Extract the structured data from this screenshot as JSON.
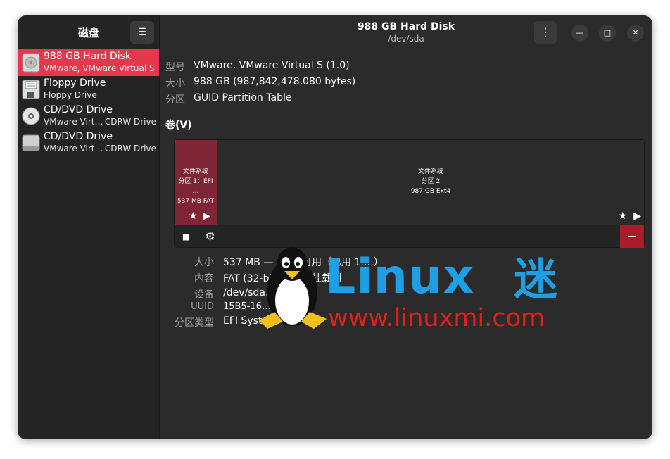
{
  "sidebar": {
    "title": "磁盘",
    "devices": [
      {
        "name": "988 GB Hard Disk",
        "sub": "VMware, VMware Virtual S",
        "sub2": "",
        "icon": "hard-disk-icon"
      },
      {
        "name": "Floppy Drive",
        "sub": "Floppy Drive",
        "sub2": "",
        "icon": "floppy-icon"
      },
      {
        "name": "CD/DVD Drive",
        "sub": "VMware Virt…",
        "sub2": "CDRW Drive",
        "icon": "cd-icon"
      },
      {
        "name": "CD/DVD Drive",
        "sub": "VMware Virt…",
        "sub2": "CDRW Drive",
        "icon": "drive-icon"
      }
    ]
  },
  "header": {
    "title": "988 GB Hard Disk",
    "subtitle": "/dev/sda"
  },
  "info": {
    "model_label": "型号",
    "model": "VMware, VMware Virtual S (1.0)",
    "size_label": "大小",
    "size": "988 GB (987,842,478,080 bytes)",
    "part_label": "分区",
    "part": "GUID Partition Table"
  },
  "volumes": {
    "title": "卷(V)",
    "p1": {
      "l1": "文件系统",
      "l2": "分区 1：EFI …",
      "l3": "537 MB FAT"
    },
    "p2": {
      "l1": "文件系统",
      "l2": "分区 2",
      "l3": "987 GB Ext4"
    }
  },
  "details": {
    "size_l": "大小",
    "size_v": "537 MB — 5…3 可用（已用 1.…）",
    "content_l": "内容",
    "content_v": "FAT (32-bit…n) — 挂载到",
    "device_l": "设备",
    "device_v": "/dev/sda…",
    "uuid_l": "UUID",
    "uuid_v": "15B5-16…",
    "ptype_l": "分区类型",
    "ptype_v": "EFI Syst…"
  },
  "watermark": {
    "brand": "Linux",
    "brand_cn": "迷",
    "url": "www.linuxmi.com"
  },
  "colors": {
    "accent": "#e5374e",
    "partition_selected": "#7f2535",
    "delete": "#a91c2a",
    "watermark_blue": "#1e9fe3",
    "watermark_red": "#e0201c"
  }
}
